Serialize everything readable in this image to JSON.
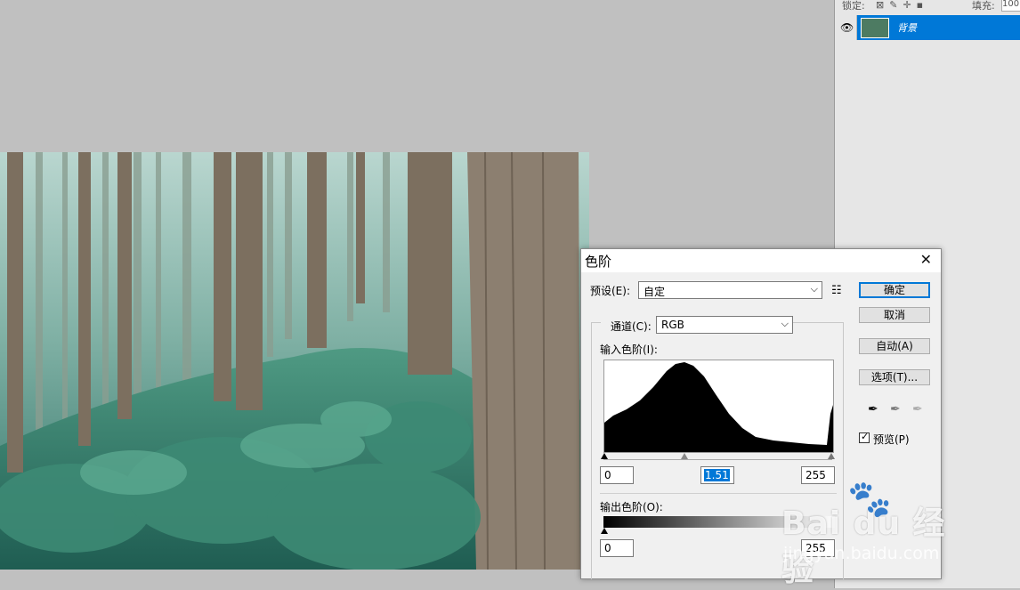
{
  "layers_panel": {
    "lock_label": "锁定:",
    "fill_label": "填充:",
    "fill_value": "100",
    "layer_name": "背景"
  },
  "dialog": {
    "title": "色阶",
    "preset_label": "预设(E):",
    "preset_value": "自定",
    "channel_label": "通道(C):",
    "channel_value": "RGB",
    "input_levels_label": "输入色阶(I):",
    "input_black": "0",
    "input_gamma": "1.51",
    "input_white": "255",
    "output_levels_label": "输出色阶(O):",
    "output_black": "0",
    "output_white": "255",
    "buttons": {
      "ok": "确定",
      "cancel": "取消",
      "auto": "自动(A)",
      "options": "选项(T)..."
    },
    "preview_label": "预览(P)",
    "preview_checked": true
  },
  "watermark": {
    "brand": "Bai du 经验",
    "url": "jingyan.baidu.com"
  }
}
